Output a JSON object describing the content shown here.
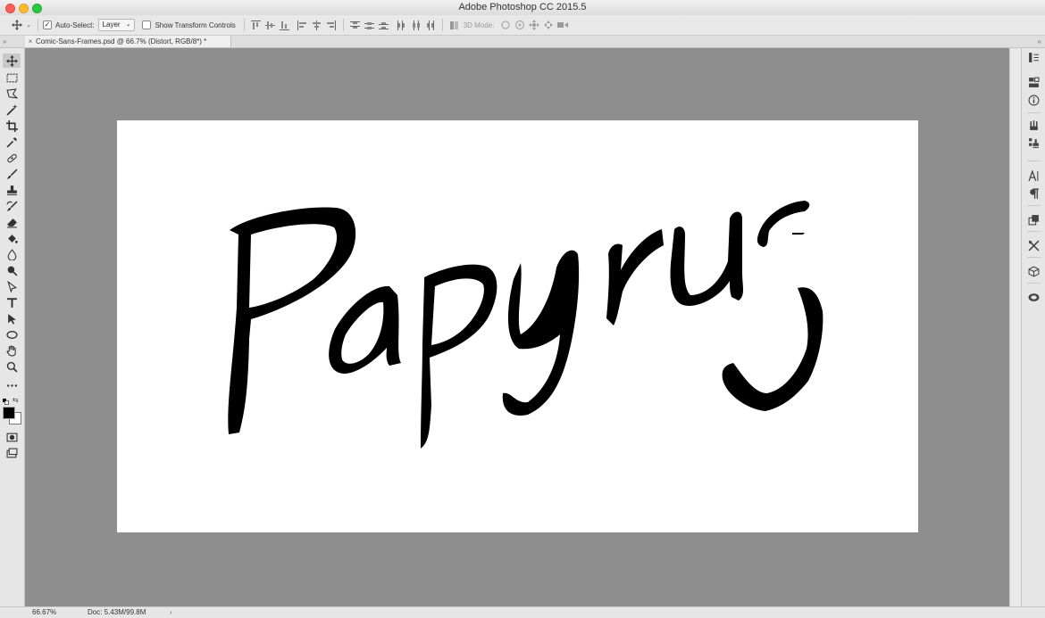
{
  "app": {
    "window_title": "Adobe Photoshop CC 2015.5"
  },
  "options_bar": {
    "move_tool_icon": "move-icon",
    "auto_select_label": "Auto-Select:",
    "auto_select_checked": true,
    "auto_select_target": "Layer",
    "show_transform_label": "Show Transform Controls",
    "show_transform_checked": false,
    "mode_3d_label": "3D Mode:"
  },
  "document_tab": {
    "close_glyph": "×",
    "title": "Comic-Sans-Frames.psd @ 66.7% (Distort, RGB/8*) *"
  },
  "canvas": {
    "text": "Papyrus",
    "background": "#ffffff",
    "pasteboard": "#8e8e8e"
  },
  "tools": [
    {
      "name": "move-tool",
      "icon": "move-icon",
      "active": true
    },
    {
      "name": "marquee-tool",
      "icon": "rect-marquee-icon"
    },
    {
      "name": "lasso-tool",
      "icon": "polygon-lasso-icon"
    },
    {
      "name": "magic-wand-tool",
      "icon": "magic-wand-icon"
    },
    {
      "name": "crop-tool",
      "icon": "crop-icon"
    },
    {
      "name": "eyedropper-tool",
      "icon": "eyedropper-icon"
    },
    {
      "name": "healing-brush-tool",
      "icon": "bandage-icon"
    },
    {
      "name": "brush-tool",
      "icon": "brush-icon"
    },
    {
      "name": "clone-stamp-tool",
      "icon": "stamp-icon"
    },
    {
      "name": "history-brush-tool",
      "icon": "history-brush-icon"
    },
    {
      "name": "eraser-tool",
      "icon": "eraser-icon"
    },
    {
      "name": "paint-bucket-tool",
      "icon": "paint-bucket-icon"
    },
    {
      "name": "blur-tool",
      "icon": "drop-icon"
    },
    {
      "name": "dodge-tool",
      "icon": "dodge-icon"
    },
    {
      "name": "pen-tool",
      "icon": "pen-icon"
    },
    {
      "name": "type-tool",
      "icon": "type-icon"
    },
    {
      "name": "path-selection-tool",
      "icon": "arrow-icon"
    },
    {
      "name": "ellipse-tool",
      "icon": "ellipse-icon"
    },
    {
      "name": "hand-tool",
      "icon": "hand-icon"
    },
    {
      "name": "zoom-tool",
      "icon": "zoom-icon"
    },
    {
      "name": "more-tools",
      "icon": "more-icon"
    }
  ],
  "colors": {
    "foreground": "#000000",
    "background": "#ffffff"
  },
  "status": {
    "zoom": "66.67%",
    "doc_info": "Doc: 5.43M/99.8M",
    "arrow": "›"
  }
}
